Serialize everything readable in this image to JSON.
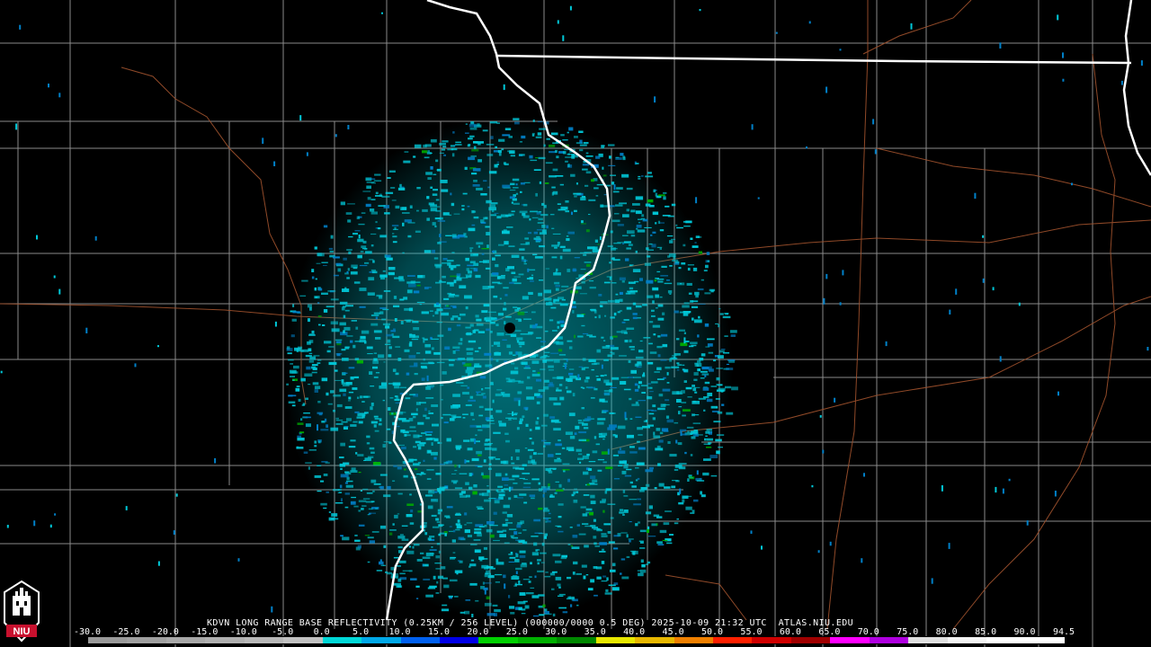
{
  "product": {
    "caption": "KDVN LONG RANGE BASE REFLECTIVITY (0.25KM / 256 LEVEL) (000000/0000 0.5 DEG) 2025-10-09 21:32 UTC  ATLAS.NIU.EDU"
  },
  "colorbar": {
    "labels": [
      "-30.0",
      "-25.0",
      "-20.0",
      "-15.0",
      "-10.0",
      "-5.0",
      "0.0",
      "5.0",
      "10.0",
      "15.0",
      "20.0",
      "25.0",
      "30.0",
      "35.0",
      "40.0",
      "45.0",
      "50.0",
      "55.0",
      "60.0",
      "65.0",
      "70.0",
      "75.0",
      "80.0",
      "85.0",
      "90.0",
      "94.5"
    ],
    "colors": [
      "#9a9a9a",
      "#a0a0a0",
      "#a8a8a8",
      "#b0b0b0",
      "#b8b8b8",
      "#c2c2c2",
      "#00d8d8",
      "#00a8e8",
      "#0060f0",
      "#0000e8",
      "#00d000",
      "#00b000",
      "#008800",
      "#e8e800",
      "#e8b800",
      "#f08000",
      "#ff2000",
      "#d00000",
      "#a00000",
      "#ff00ff",
      "#b000e0",
      "#e0e0e0",
      "#f4f4f4",
      "#ffffff",
      "#ffffff"
    ]
  },
  "logo": {
    "text": "NIU",
    "color": "#c8102e"
  },
  "map": {
    "background_color": "#000000",
    "state_border_color": "#ffffff",
    "county_line_color": "#8a8a8a",
    "highway_color": "#a0522d",
    "echo_color": "#00c8d8",
    "echo_dark_color": "#0080c8",
    "echo_accent_color": "#00b000"
  }
}
